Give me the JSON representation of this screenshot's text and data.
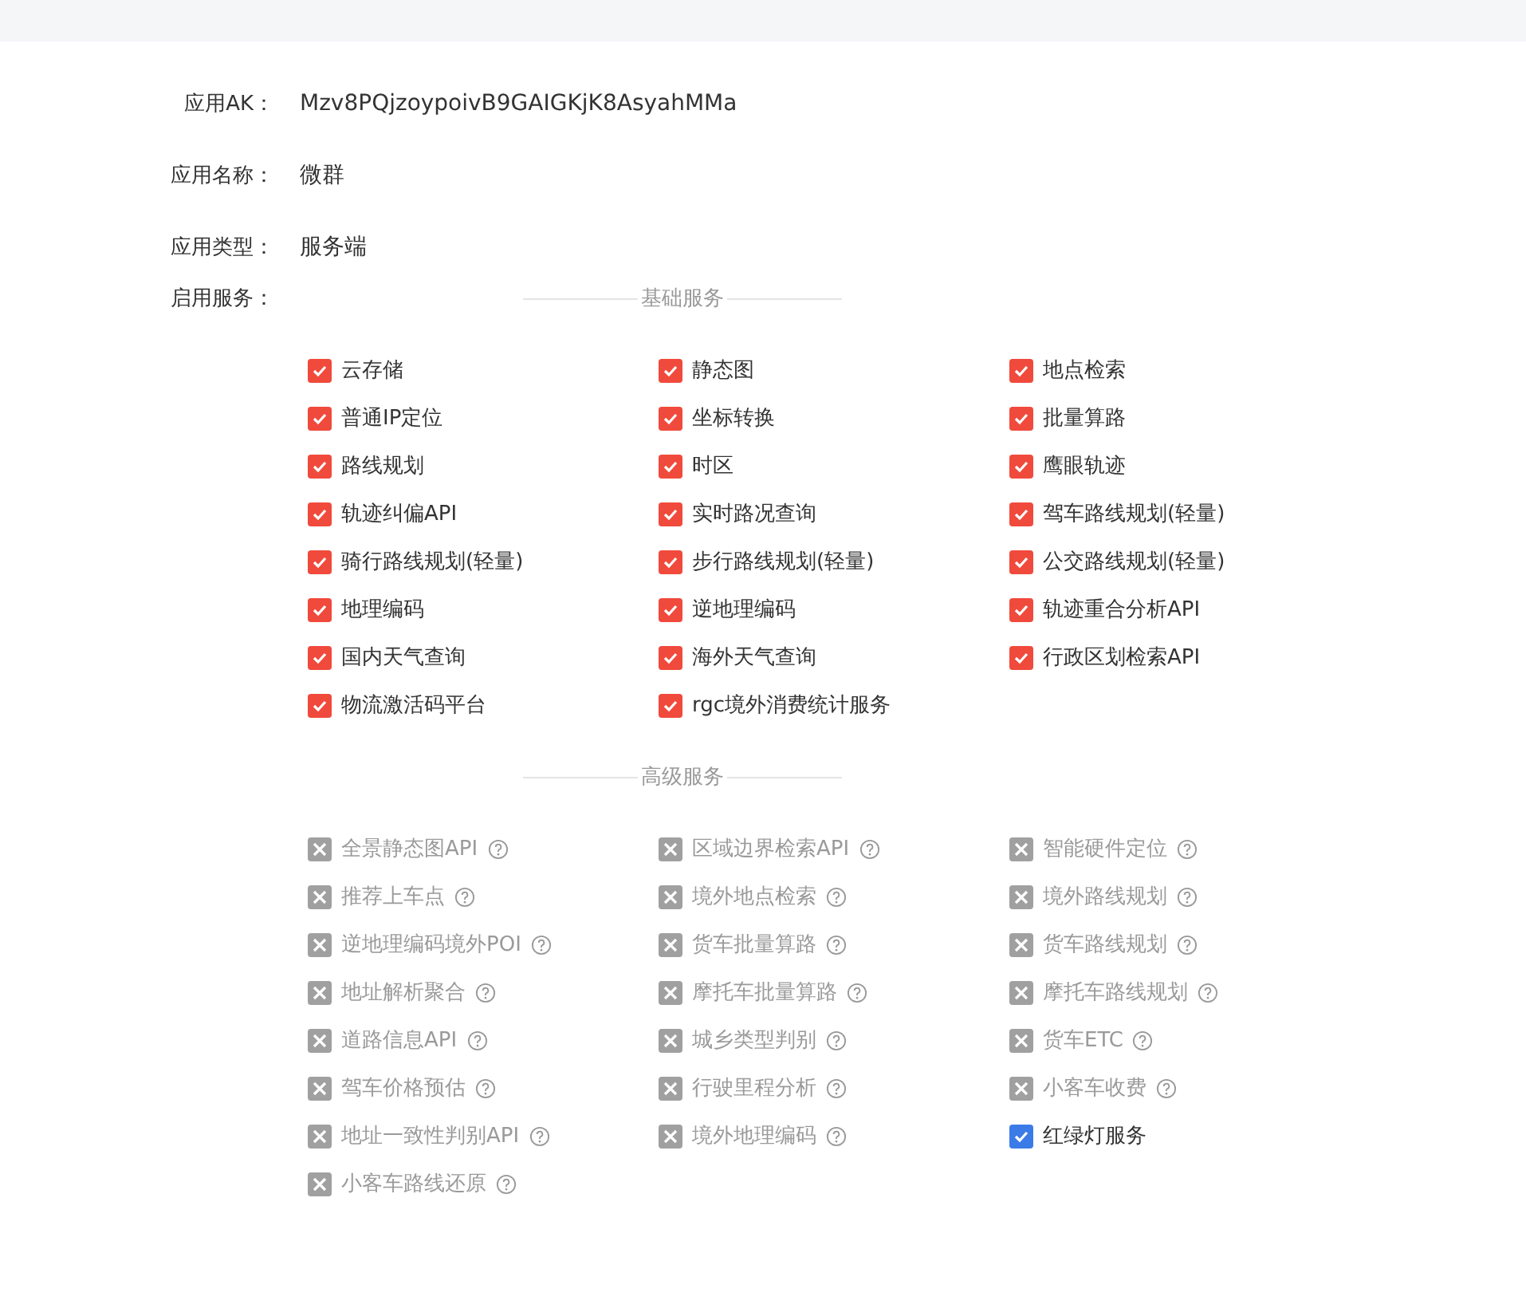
{
  "fields": [
    {
      "label": "应用AK：",
      "value": "Mzv8PQjzoypoivB9GAIGKjK8AsyahMMa"
    },
    {
      "label": "应用名称：",
      "value": "微群"
    },
    {
      "label": "应用类型：",
      "value": "服务端"
    }
  ],
  "services": {
    "label": "启用服务：",
    "sections": [
      {
        "title": "基础服务",
        "kind": "basic",
        "items": [
          {
            "name": "云存储",
            "checked": true,
            "disabled": false
          },
          {
            "name": "静态图",
            "checked": true,
            "disabled": false
          },
          {
            "name": "地点检索",
            "checked": true,
            "disabled": false
          },
          {
            "name": "普通IP定位",
            "checked": true,
            "disabled": false
          },
          {
            "name": "坐标转换",
            "checked": true,
            "disabled": false
          },
          {
            "name": "批量算路",
            "checked": true,
            "disabled": false
          },
          {
            "name": "路线规划",
            "checked": true,
            "disabled": false
          },
          {
            "name": "时区",
            "checked": true,
            "disabled": false
          },
          {
            "name": "鹰眼轨迹",
            "checked": true,
            "disabled": false
          },
          {
            "name": "轨迹纠偏API",
            "checked": true,
            "disabled": false
          },
          {
            "name": "实时路况查询",
            "checked": true,
            "disabled": false
          },
          {
            "name": "驾车路线规划(轻量)",
            "checked": true,
            "disabled": false
          },
          {
            "name": "骑行路线规划(轻量)",
            "checked": true,
            "disabled": false
          },
          {
            "name": "步行路线规划(轻量)",
            "checked": true,
            "disabled": false
          },
          {
            "name": "公交路线规划(轻量)",
            "checked": true,
            "disabled": false
          },
          {
            "name": "地理编码",
            "checked": true,
            "disabled": false
          },
          {
            "name": "逆地理编码",
            "checked": true,
            "disabled": false
          },
          {
            "name": "轨迹重合分析API",
            "checked": true,
            "disabled": false
          },
          {
            "name": "国内天气查询",
            "checked": true,
            "disabled": false
          },
          {
            "name": "海外天气查询",
            "checked": true,
            "disabled": false
          },
          {
            "name": "行政区划检索API",
            "checked": true,
            "disabled": false
          },
          {
            "name": "物流激活码平台",
            "checked": true,
            "disabled": false
          },
          {
            "name": "rgc境外消费统计服务",
            "checked": true,
            "disabled": false
          }
        ]
      },
      {
        "title": "高级服务",
        "kind": "advanced",
        "items": [
          {
            "name": "全景静态图API",
            "checked": false,
            "disabled": true
          },
          {
            "name": "区域边界检索API",
            "checked": false,
            "disabled": true
          },
          {
            "name": "智能硬件定位",
            "checked": false,
            "disabled": true
          },
          {
            "name": "推荐上车点",
            "checked": false,
            "disabled": true
          },
          {
            "name": "境外地点检索",
            "checked": false,
            "disabled": true
          },
          {
            "name": "境外路线规划",
            "checked": false,
            "disabled": true
          },
          {
            "name": "逆地理编码境外POI",
            "checked": false,
            "disabled": true
          },
          {
            "name": "货车批量算路",
            "checked": false,
            "disabled": true
          },
          {
            "name": "货车路线规划",
            "checked": false,
            "disabled": true
          },
          {
            "name": "地址解析聚合",
            "checked": false,
            "disabled": true
          },
          {
            "name": "摩托车批量算路",
            "checked": false,
            "disabled": true
          },
          {
            "name": "摩托车路线规划",
            "checked": false,
            "disabled": true
          },
          {
            "name": "道路信息API",
            "checked": false,
            "disabled": true
          },
          {
            "name": "城乡类型判别",
            "checked": false,
            "disabled": true
          },
          {
            "name": "货车ETC",
            "checked": false,
            "disabled": true
          },
          {
            "name": "驾车价格预估",
            "checked": false,
            "disabled": true
          },
          {
            "name": "行驶里程分析",
            "checked": false,
            "disabled": true
          },
          {
            "name": "小客车收费",
            "checked": false,
            "disabled": true
          },
          {
            "name": "地址一致性判别API",
            "checked": false,
            "disabled": true
          },
          {
            "name": "境外地理编码",
            "checked": false,
            "disabled": true
          },
          {
            "name": "红绿灯服务",
            "checked": true,
            "disabled": false
          },
          {
            "name": "小客车路线还原",
            "checked": false,
            "disabled": true
          }
        ]
      }
    ]
  }
}
